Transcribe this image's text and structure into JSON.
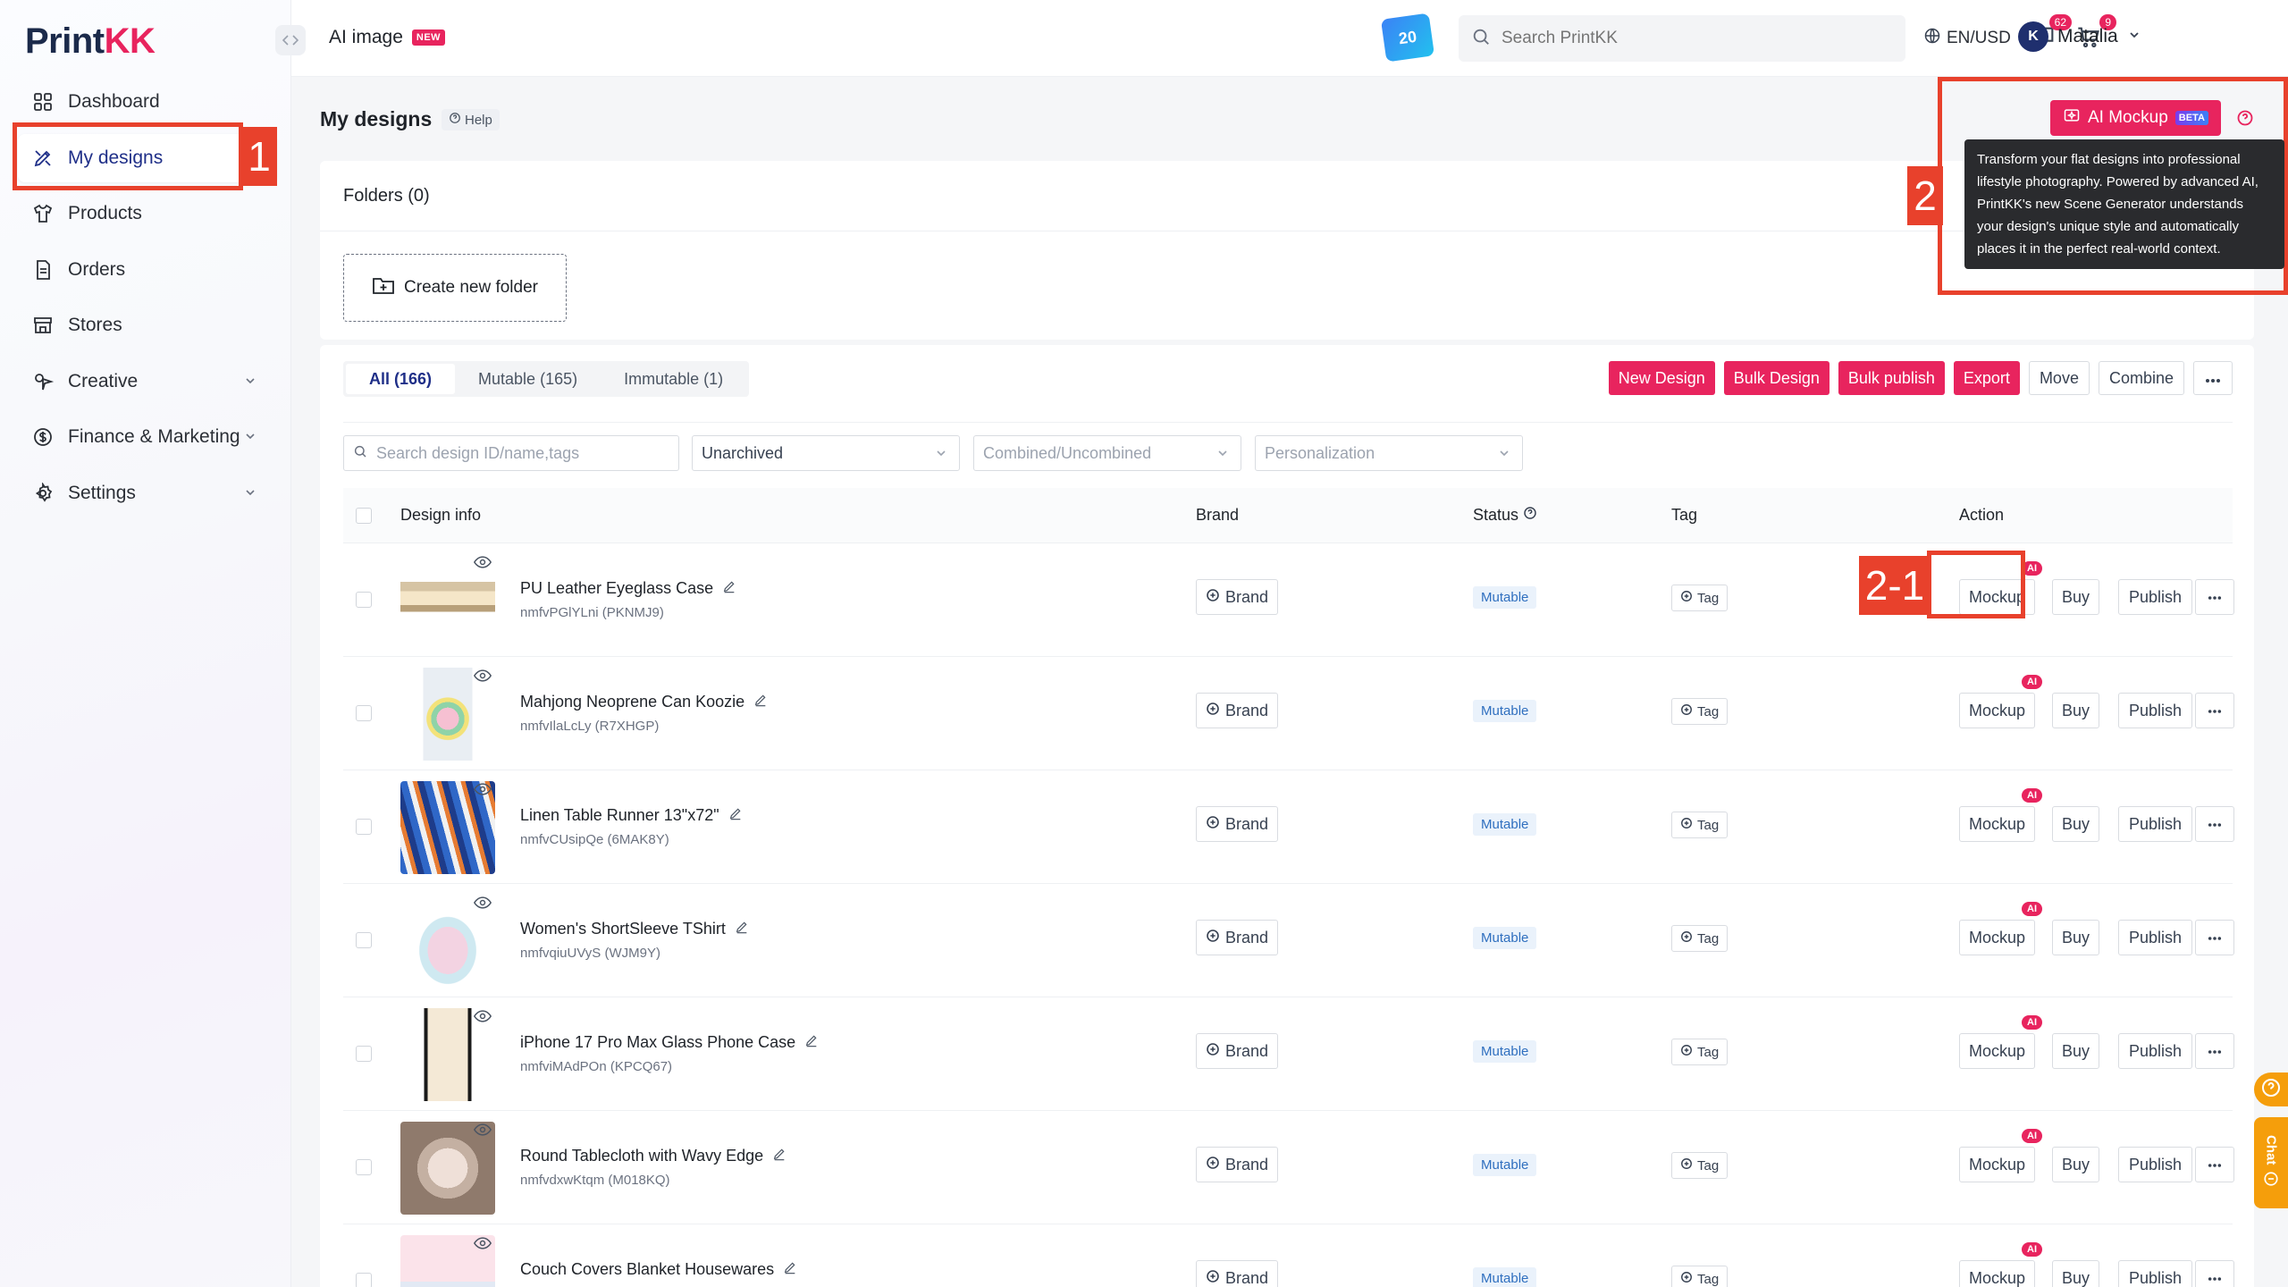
{
  "brand": {
    "logo_prefix": "Print",
    "logo_suffix": "KK",
    "accent": "#e8245e",
    "navy": "#1f2f88"
  },
  "sidebar": {
    "items": [
      {
        "label": "Dashboard",
        "icon": "dashboard-icon"
      },
      {
        "label": "My designs",
        "icon": "designs-icon",
        "active": true
      },
      {
        "label": "Products",
        "icon": "tshirt-icon"
      },
      {
        "label": "Orders",
        "icon": "orders-icon"
      },
      {
        "label": "Stores",
        "icon": "store-icon"
      },
      {
        "label": "Creative",
        "icon": "creative-icon",
        "expandable": true
      },
      {
        "label": "Finance & Marketing",
        "icon": "finance-icon",
        "expandable": true
      },
      {
        "label": "Settings",
        "icon": "gear-icon",
        "expandable": true
      }
    ]
  },
  "topbar": {
    "ai_image": "AI image",
    "new_badge": "NEW",
    "promo": "20",
    "search_placeholder": "Search PrintKK",
    "lang": "EN/USD",
    "messages_count": "62",
    "cart_count": "9",
    "user_initial": "K",
    "user_name": "Matalia"
  },
  "annotations": {
    "a1": "1",
    "a2": "2",
    "a21": "2-1"
  },
  "page": {
    "title": "My designs",
    "help": "Help"
  },
  "ai_mockup": {
    "label": "AI Mockup",
    "beta": "BETA",
    "tooltip": "Transform your flat designs into professional lifestyle photography. Powered by advanced AI, PrintKK's new Scene Generator understands your design's unique style and automatically places it in the perfect real-world context."
  },
  "folders": {
    "title": "Folders (0)",
    "create": "Create new folder"
  },
  "tabs": [
    {
      "label": "All (166)",
      "active": true
    },
    {
      "label": "Mutable (165)"
    },
    {
      "label": "Immutable (1)"
    }
  ],
  "actions": {
    "new_design": "New Design",
    "bulk_design": "Bulk Design",
    "bulk_publish": "Bulk publish",
    "export": "Export",
    "move": "Move",
    "combine": "Combine"
  },
  "filters": {
    "search_placeholder": "Search design ID/name,tags",
    "archive": "Unarchived",
    "combined": "Combined/Uncombined",
    "personalization": "Personalization"
  },
  "columns": {
    "design_info": "Design info",
    "brand": "Brand",
    "status": "Status",
    "tag": "Tag",
    "action": "Action"
  },
  "row_labels": {
    "brand": "Brand",
    "tag": "Tag",
    "mockup": "Mockup",
    "ai": "AI",
    "buy": "Buy",
    "publish": "Publish"
  },
  "rows": [
    {
      "name": "PU Leather Eyeglass Case",
      "sku": "nmfvPGlYLni (PKNMJ9)",
      "status": "Mutable"
    },
    {
      "name": "Mahjong Neoprene Can Koozie",
      "sku": "nmfvIlaLcLy (R7XHGP)",
      "status": "Mutable"
    },
    {
      "name": "Linen Table Runner 13\"x72\"",
      "sku": "nmfvCUsipQe (6MAK8Y)",
      "status": "Mutable"
    },
    {
      "name": "Women's ShortSleeve TShirt",
      "sku": "nmfvqiuUVyS (WJM9Y)",
      "status": "Mutable"
    },
    {
      "name": "iPhone 17 Pro Max Glass Phone Case",
      "sku": "nmfviMAdPOn (KPCQ67)",
      "status": "Mutable"
    },
    {
      "name": "Round Tablecloth with Wavy Edge",
      "sku": "nmfvdxwKtqm (M018KQ)",
      "status": "Mutable"
    },
    {
      "name": "Couch Covers Blanket Housewares",
      "sku": "",
      "status": "Mutable"
    }
  ],
  "float": {
    "chat": "Chat"
  }
}
